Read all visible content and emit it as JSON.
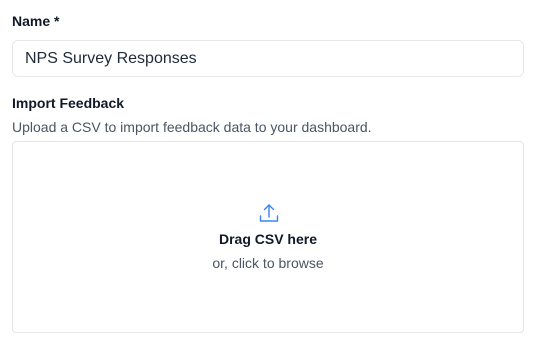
{
  "name_field": {
    "label": "Name *",
    "value": "NPS Survey Responses"
  },
  "import_section": {
    "label": "Import Feedback",
    "help_text": "Upload a CSV to import feedback data to your dashboard.",
    "dropzone": {
      "icon": "upload-icon",
      "title": "Drag CSV here",
      "subtitle": "or, click to browse"
    }
  },
  "colors": {
    "accent": "#3b82f6",
    "border": "#e5e7eb",
    "muted_text": "#4b5563"
  }
}
